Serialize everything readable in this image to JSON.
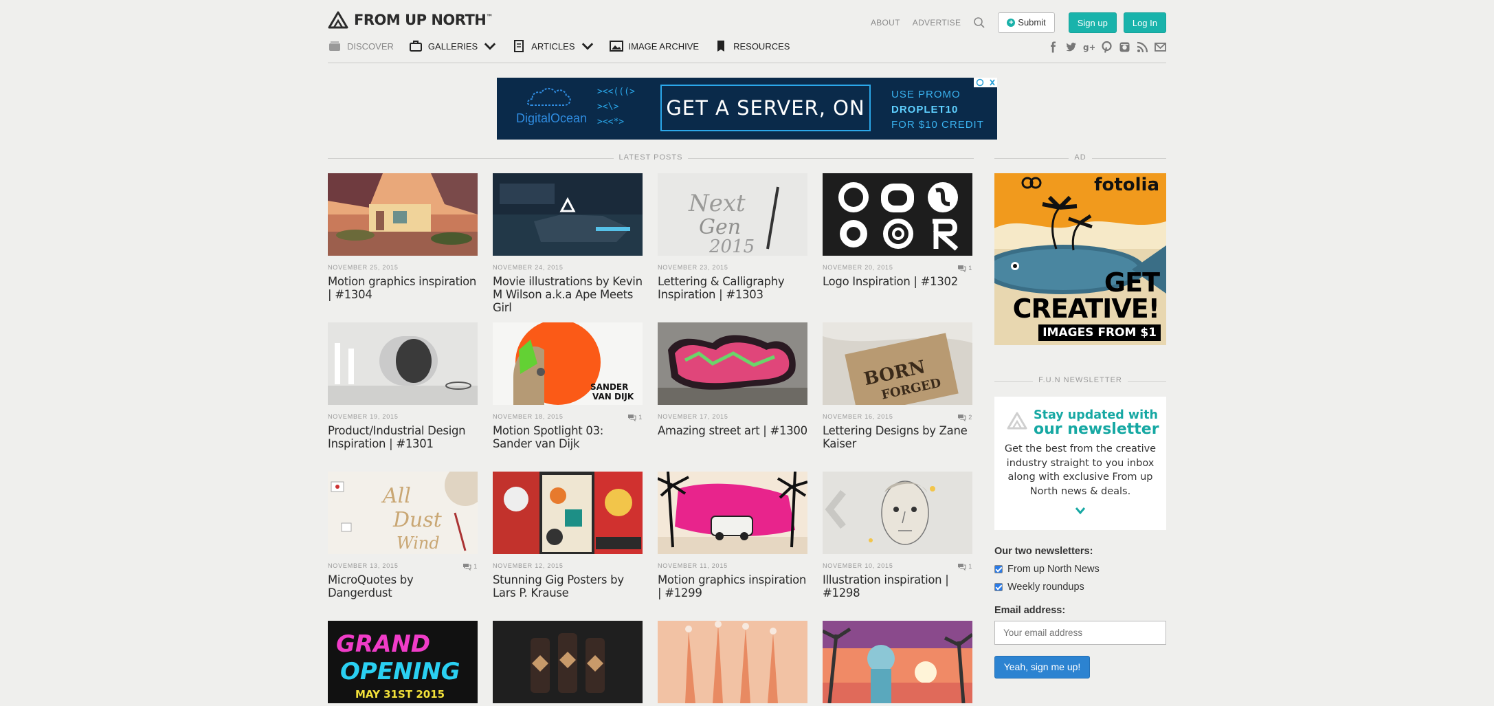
{
  "header": {
    "logo_text": "FROM UP NORTH",
    "logo_tm": "™",
    "links": [
      "ABOUT",
      "ADVERTISE"
    ],
    "submit_label": "Submit",
    "signup_label": "Sign up",
    "login_label": "Log In"
  },
  "nav": {
    "discover": "DISCOVER",
    "galleries": "GALLERIES",
    "articles": "ARTICLES",
    "image_archive": "IMAGE ARCHIVE",
    "resources": "RESOURCES"
  },
  "social_icons": [
    "facebook-icon",
    "twitter-icon",
    "google-plus-icon",
    "pinterest-icon",
    "instagram-icon",
    "rss-icon",
    "mail-icon"
  ],
  "banner": {
    "brand": "DigitalOcean",
    "fish_line1": "><<(((>",
    "fish_line2": "><\\>",
    "fish_line3": "><<*>",
    "cta": "GET A SERVER, ON US",
    "promo_line1": "USE PROMO",
    "promo_code": "DROPLET10",
    "promo_line3": "FOR $10 CREDIT"
  },
  "latest_posts_heading": "LATEST POSTS",
  "posts": [
    {
      "date": "NOVEMBER 25, 2015",
      "title": "Motion graphics inspiration | #1304",
      "comments": ""
    },
    {
      "date": "NOVEMBER 24, 2015",
      "title": "Movie illustrations by Kevin M Wilson a.k.a Ape Meets Girl",
      "comments": ""
    },
    {
      "date": "NOVEMBER 23, 2015",
      "title": "Lettering & Calligraphy Inspiration | #1303",
      "comments": ""
    },
    {
      "date": "NOVEMBER 20, 2015",
      "title": "Logo Inspiration | #1302",
      "comments": "1"
    },
    {
      "date": "NOVEMBER 19, 2015",
      "title": "Product/Industrial Design Inspiration | #1301",
      "comments": ""
    },
    {
      "date": "NOVEMBER 18, 2015",
      "title": "Motion Spotlight 03: Sander van Dijk",
      "comments": "1"
    },
    {
      "date": "NOVEMBER 17, 2015",
      "title": "Amazing street art | #1300",
      "comments": ""
    },
    {
      "date": "NOVEMBER 16, 2015",
      "title": "Lettering Designs by Zane Kaiser",
      "comments": "2"
    },
    {
      "date": "NOVEMBER 13, 2015",
      "title": "MicroQuotes by Dangerdust",
      "comments": "1"
    },
    {
      "date": "NOVEMBER 12, 2015",
      "title": "Stunning Gig Posters by Lars P. Krause",
      "comments": ""
    },
    {
      "date": "NOVEMBER 11, 2015",
      "title": "Motion graphics inspiration | #1299",
      "comments": ""
    },
    {
      "date": "NOVEMBER 10, 2015",
      "title": "Illustration inspiration | #1298",
      "comments": "1"
    }
  ],
  "thumb_texts": {
    "sander": "SANDER\nVAN DIJK",
    "grand": "GRAND OPENING",
    "may": "MAY 31ST 2015"
  },
  "sidebar": {
    "ad_heading": "AD",
    "ad_brand": "fotolia",
    "ad_get": "GET",
    "ad_creative": "CREATIVE!",
    "ad_images": "IMAGES FROM $1",
    "newsletter_heading": "F.U.N NEWSLETTER",
    "nl_title1": "Stay updated with",
    "nl_title2": "our newsletter",
    "nl_body": "Get the best from the creative industry straight to you inbox along with exclusive From up North news & deals.",
    "two_newsletters": "Our two newsletters:",
    "option1": "From up North News",
    "option2": "Weekly roundups",
    "email_label": "Email address:",
    "email_placeholder": "Your email address",
    "signup_button": "Yeah, sign me up!"
  },
  "colors": {
    "background": "#efefed",
    "teal": "#19b3ab",
    "blue_button": "#2c83d1",
    "ad_orange": "#f19a1d",
    "banner_navy": "#0a2a4a"
  }
}
